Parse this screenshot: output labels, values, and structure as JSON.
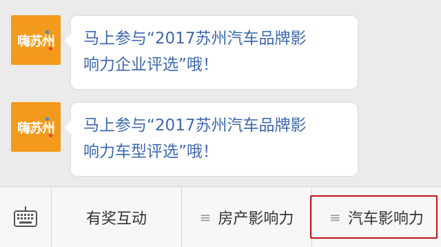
{
  "chat": {
    "messages": [
      {
        "avatar_text": "嗨苏州",
        "text_line1": "马上参与“2017苏州汽车品牌影",
        "text_line2": "响力企业评选”哦！"
      },
      {
        "avatar_text": "嗨苏州",
        "text_line1": "马上参与“2017苏州汽车品牌影",
        "text_line2": "响力车型评选”哦！"
      }
    ]
  },
  "menubar": {
    "keyboard_icon": "keyboard-icon",
    "items": [
      {
        "label": "有奖互动",
        "has_submenu": false
      },
      {
        "label": "房产影响力",
        "has_submenu": true,
        "icon": "menu-lines-icon"
      },
      {
        "label": "汽车影响力",
        "has_submenu": true,
        "icon": "menu-lines-icon",
        "highlighted": true
      }
    ]
  },
  "colors": {
    "background": "#ebebeb",
    "avatar": "#f39a1c",
    "link_text": "#3e68ad",
    "highlight_border": "#c0141a"
  }
}
